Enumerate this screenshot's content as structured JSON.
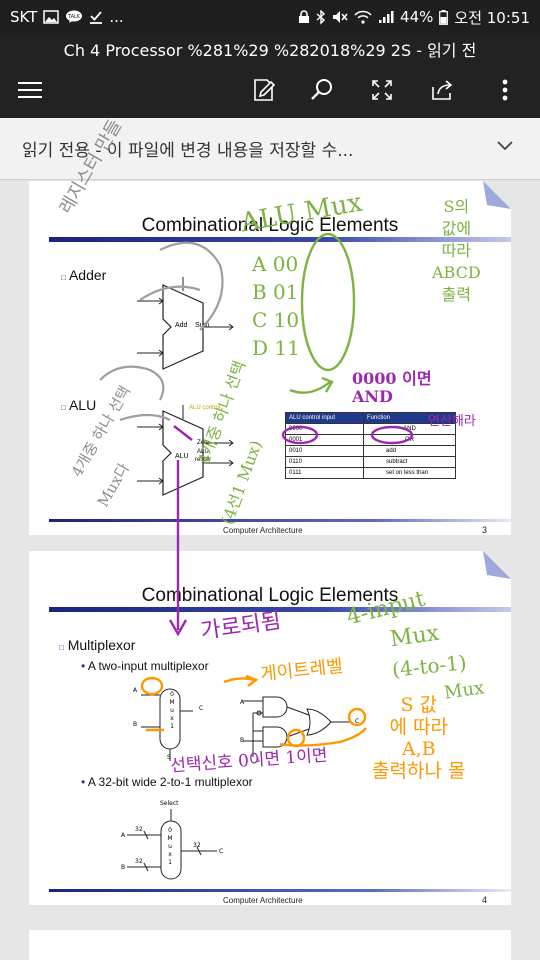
{
  "status_bar": {
    "carrier": "SKT",
    "ellipsis": "...",
    "battery": "44%",
    "time": "오전 10:51"
  },
  "header": {
    "title": "Ch 4 Processor %281%29 %282018%29 2S - 읽기 전"
  },
  "banner": {
    "text": "읽기 전용 - 이 파일에 변경 내용을 저장할 수..."
  },
  "slide1": {
    "title": "Combinational Logic Elements",
    "bullet1": "Adder",
    "bullet2": "ALU",
    "adder_add": "Add",
    "adder_sum": "Sum",
    "alu_label": "ALU",
    "alu_control": "ALU control",
    "alu_zero": "Zero",
    "alu_result1": "ALU",
    "alu_result2": "result",
    "table_headers": [
      "ALU control input",
      "Function"
    ],
    "table_rows": [
      [
        "0000",
        "AND"
      ],
      [
        "0001",
        "OR"
      ],
      [
        "0010",
        "add"
      ],
      [
        "0110",
        "subtract"
      ],
      [
        "0111",
        "set on less than"
      ]
    ],
    "footer": "Computer Architecture",
    "page": "3"
  },
  "slide2": {
    "title": "Combinational Logic Elements",
    "bullet1": "Multiplexor",
    "sub1": "A two-input multiplexor",
    "sub2": "A 32-bit wide 2-to-1 multiplexor",
    "mux_letters": [
      "0",
      "M",
      "u",
      "x",
      "1"
    ],
    "label_a": "A",
    "label_b": "B",
    "label_c": "C",
    "label_s": "S",
    "select_label": "Select",
    "width_label": "32",
    "footer": "Computer Architecture",
    "page": "4"
  },
  "annotations": {
    "green": {
      "alu_mux": "ALU Mux",
      "mux_4input_1": "4-input",
      "mux_4input_2": "Mux",
      "mux_4to1_1": "(4-to-1)",
      "mux_4to1_2": "Mux",
      "s_ab_1": "A 00",
      "s_ab_2": "B 01",
      "s_ab_3": "C 10",
      "s_ab_4": "D 11",
      "right_note_1": "S의",
      "right_note_2": "값에",
      "right_note_3": "따라",
      "right_note_4": "ABCD",
      "right_note_5": "출력",
      "mid_note": "4개중 하나 선택",
      "vertical_note": "(4선1 Mux)"
    },
    "gray": {
      "left_note_1": "레지스터 만들",
      "left_note_2": "4개중 하나 선택",
      "left_note_3": "Mux다"
    },
    "purple": {
      "and_note": "0000 이면 AND",
      "right_note": "연산해라",
      "bottom_note": "가로되됨",
      "select_note": "선택신호 0이면 1이면"
    },
    "orange": {
      "gate_note": "게이트레벨",
      "s_note_1": "S 값",
      "s_note_2": "에 따라",
      "s_note_3": "A,B",
      "s_note_4": "출력하나 몰"
    }
  }
}
